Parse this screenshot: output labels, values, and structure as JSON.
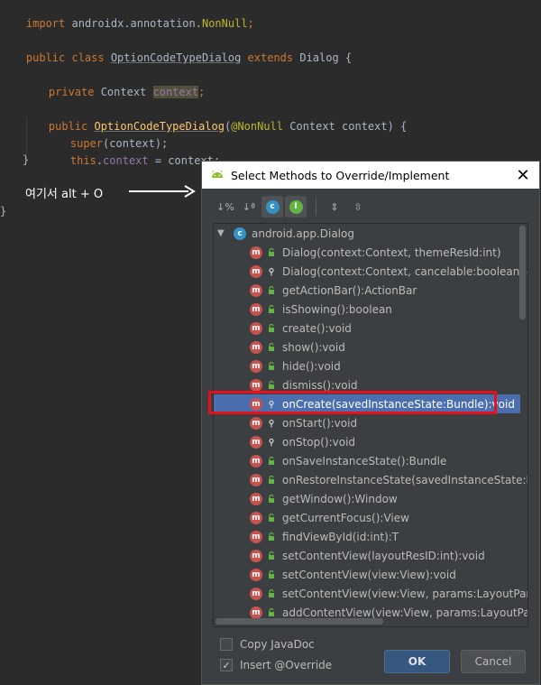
{
  "editor": {
    "line_import": [
      "import",
      " androidx.annotation.",
      "NonNull",
      ";"
    ],
    "line_class": [
      "public class ",
      "OptionCodeTypeDialog",
      " extends ",
      "Dialog {"
    ],
    "line_field": [
      "private ",
      "Context ",
      "context",
      ";"
    ],
    "line_ctor": [
      "public ",
      "OptionCodeTypeDialog",
      "(",
      "@NonNull",
      " Context context) {"
    ],
    "line_super": [
      "super",
      "(context);"
    ],
    "line_this": [
      "this",
      ".",
      "context",
      " = context;"
    ],
    "close_brace_inner": "}",
    "close_brace_outer": "}"
  },
  "annotation": {
    "note_text": "여기서 alt + O"
  },
  "dialog": {
    "title": "Select Methods to Override/Implement",
    "root_label": "android.app.Dialog",
    "methods": [
      {
        "label": "Dialog(context:Context, themeResId:int)",
        "vis": "public"
      },
      {
        "label": "Dialog(context:Context, cancelable:boolean, cancel",
        "vis": "protected"
      },
      {
        "label": "getActionBar():ActionBar",
        "vis": "public"
      },
      {
        "label": "isShowing():boolean",
        "vis": "public"
      },
      {
        "label": "create():void",
        "vis": "public"
      },
      {
        "label": "show():void",
        "vis": "public"
      },
      {
        "label": "hide():void",
        "vis": "public"
      },
      {
        "label": "dismiss():void",
        "vis": "public"
      },
      {
        "label": "onCreate(savedInstanceState:Bundle):void",
        "vis": "protected"
      },
      {
        "label": "onStart():void",
        "vis": "protected"
      },
      {
        "label": "onStop():void",
        "vis": "protected"
      },
      {
        "label": "onSaveInstanceState():Bundle",
        "vis": "public"
      },
      {
        "label": "onRestoreInstanceState(savedInstanceState:Bundle):",
        "vis": "public"
      },
      {
        "label": "getWindow():Window",
        "vis": "public"
      },
      {
        "label": "getCurrentFocus():View",
        "vis": "public"
      },
      {
        "label": "findViewById(id:int):T",
        "vis": "public"
      },
      {
        "label": "setContentView(layoutResID:int):void",
        "vis": "public"
      },
      {
        "label": "setContentView(view:View):void",
        "vis": "public"
      },
      {
        "label": "setContentView(view:View, params:LayoutParams):v",
        "vis": "public"
      },
      {
        "label": "addContentView(view:View, params:LayoutParams)",
        "vis": "public"
      }
    ],
    "selected_method": "onCreate(savedInstanceState:Bundle):void",
    "copy_javadoc_label": "Copy JavaDoc",
    "copy_javadoc_checked": false,
    "insert_override_label": "Insert @Override",
    "insert_override_checked": true,
    "ok_label": "OK",
    "cancel_label": "Cancel"
  }
}
